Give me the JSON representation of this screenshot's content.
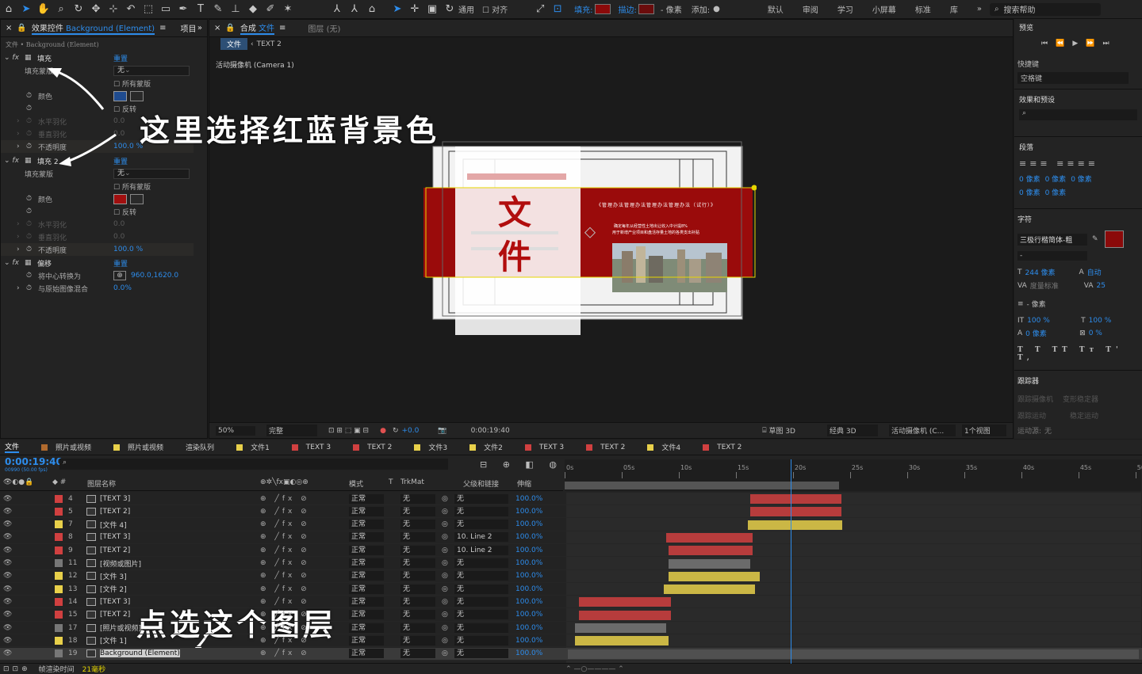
{
  "toolbar": {
    "snap_label": "通用",
    "align_label": "对齐",
    "fill_label": "填充:",
    "stroke_label": "描边:",
    "stroke_px": "- 像素",
    "add_label": "添加:",
    "workspaces": [
      "默认",
      "审阅",
      "学习",
      "小屏幕",
      "标准",
      "库"
    ],
    "search_help": "搜索帮助"
  },
  "effects_panel": {
    "tab": "效果控件",
    "layer_name": "Background (Element)",
    "tab2": "项目",
    "breadcrumb": "文件 • Background (Element)",
    "fill1": {
      "name": "填充",
      "reset": "重置",
      "mask_label": "填充蒙版",
      "mask_value": "无",
      "all_masks": "所有蒙版",
      "color_label": "颜色",
      "color": "#1f4b8e",
      "invert": "反转",
      "h_feather": "水平羽化",
      "h_feather_val": "0.0",
      "v_feather": "垂直羽化",
      "v_feather_val": "0.0",
      "opacity_label": "不透明度",
      "opacity": "100.0 %"
    },
    "fill2": {
      "name": "填充 2",
      "reset": "重置",
      "mask_label": "填充蒙版",
      "mask_value": "无",
      "all_masks": "所有蒙版",
      "color_label": "颜色",
      "color": "#a00f0f",
      "invert": "反转",
      "h_feather": "水平羽化",
      "h_feather_val": "0.0",
      "v_feather": "垂直羽化",
      "v_feather_val": "0.0",
      "opacity_label": "不透明度",
      "opacity": "100.0 %"
    },
    "offset": {
      "name": "偏移",
      "reset": "重置",
      "shift_label": "将中心转换为",
      "shift_val": "960.0,1620.0",
      "blend_label": "与原始图像混合",
      "blend_val": "0.0%"
    }
  },
  "comp_panel": {
    "tab_prefix": "合成",
    "tab_name": "文件",
    "layer_tab": "图层 (无)",
    "crumb1": "文件",
    "crumb2": "TEXT 2",
    "camera_label": "活动摄像机 (Camera 1)",
    "zoom": "50%",
    "quality": "完整",
    "exposure": "+0.0",
    "timecode": "0:00:19:40",
    "draft3d": "草图 3D",
    "renderer": "经典 3D",
    "camera_dd": "活动摄像机 (C...",
    "views": "1个视图"
  },
  "canvas": {
    "title_char1": "文",
    "title_char2": "件",
    "doc_title": "《管理办法管理办法管理办法管理办法（试行）》",
    "doc_line1": "确定每年从经营性土地出让收入中计提8%",
    "doc_line2": "用于新增产业项目和盘活存量土地的各类支出补贴"
  },
  "annotations": {
    "top": "这里选择红蓝背景色",
    "bottom": "点选这个图层"
  },
  "right_panel": {
    "preview": "预览",
    "shortcut": "快捷键",
    "shortcut_val": "空格键",
    "effects_presets": "效果和预设",
    "paragraph": "段落",
    "para_vals": [
      "0 像素",
      "0 像素",
      "0 像素",
      "0 像素",
      "0 像素"
    ],
    "character": "字符",
    "font": "三极行楷简体-粗",
    "font_style": "-",
    "font_size": "244 像素",
    "leading": "自动",
    "kerning": "度量标准",
    "tracking": "25",
    "stroke_w": "- 像素",
    "vscale": "100 %",
    "hscale": "100 %",
    "baseline": "0 像素",
    "tsume": "0 %",
    "text_color": "#8b0a0a",
    "tracker": "跟踪器",
    "track_camera": "跟踪摄像机",
    "warp_stab": "变形稳定器",
    "track_motion": "跟踪运动",
    "stabilize": "稳定运动",
    "motion_source": "运动源:",
    "motion_source_val": "无"
  },
  "timeline": {
    "tabs": [
      {
        "name": "文件",
        "color": "",
        "active": true
      },
      {
        "name": "照片或视频",
        "color": "#b06a2e"
      },
      {
        "name": "照片或视频",
        "color": "#e8d04a"
      },
      {
        "name": "渲染队列",
        "color": ""
      },
      {
        "name": "文件1",
        "color": "#e8d04a"
      },
      {
        "name": "TEXT 3",
        "color": "#d04040"
      },
      {
        "name": "TEXT 2",
        "color": "#d04040"
      },
      {
        "name": "文件3",
        "color": "#e8d04a"
      },
      {
        "name": "文件2",
        "color": "#e8d04a"
      },
      {
        "name": "TEXT 3",
        "color": "#d04040"
      },
      {
        "name": "TEXT 2",
        "color": "#d04040"
      },
      {
        "name": "文件4",
        "color": "#e8d04a"
      },
      {
        "name": "TEXT 2",
        "color": "#d04040"
      }
    ],
    "current_time": "0:00:19:40",
    "frame_info": "00990 (50.00 fps)",
    "col_name": "图层名称",
    "col_mode": "模式",
    "col_t": "T",
    "col_trkmat": "TrkMat",
    "col_parent": "父级和链接",
    "col_stretch": "伸缩",
    "ruler": [
      "0s",
      "05s",
      "10s",
      "15s",
      "20s",
      "25s",
      "30s",
      "35s",
      "40s",
      "45s",
      "50s"
    ],
    "playhead_sec": 19.8,
    "work_area_sec": [
      0,
      24
    ],
    "layers": [
      {
        "num": "4",
        "name": "[TEXT 3]",
        "color": "#d04040",
        "mode": "正常",
        "trk": "无",
        "parent": "无",
        "stretch": "100.0%",
        "start": 16,
        "end": 24
      },
      {
        "num": "5",
        "name": "[TEXT 2]",
        "color": "#d04040",
        "mode": "正常",
        "trk": "无",
        "parent": "无",
        "stretch": "100.0%",
        "start": 16,
        "end": 24
      },
      {
        "num": "7",
        "name": "[文件 4]",
        "color": "#e8d04a",
        "mode": "正常",
        "trk": "无",
        "parent": "无",
        "stretch": "100.0%",
        "start": 15.8,
        "end": 24
      },
      {
        "num": "8",
        "name": "[TEXT 3]",
        "color": "#d04040",
        "mode": "正常",
        "trk": "无",
        "parent": "10. Line 2",
        "stretch": "100.0%",
        "start": 8.6,
        "end": 16.2
      },
      {
        "num": "9",
        "name": "[TEXT 2]",
        "color": "#d04040",
        "mode": "正常",
        "trk": "无",
        "parent": "10. Line 2",
        "stretch": "100.0%",
        "start": 8.8,
        "end": 16.2
      },
      {
        "num": "11",
        "name": "[视频或图片]",
        "color": "#777777",
        "mode": "正常",
        "trk": "无",
        "parent": "无",
        "stretch": "100.0%",
        "start": 8.8,
        "end": 16
      },
      {
        "num": "12",
        "name": "[文件 3]",
        "color": "#e8d04a",
        "mode": "正常",
        "trk": "无",
        "parent": "无",
        "stretch": "100.0%",
        "start": 8.8,
        "end": 16.8
      },
      {
        "num": "13",
        "name": "[文件 2]",
        "color": "#e8d04a",
        "mode": "正常",
        "trk": "无",
        "parent": "无",
        "stretch": "100.0%",
        "start": 8.4,
        "end": 16.4
      },
      {
        "num": "14",
        "name": "[TEXT 3]",
        "color": "#d04040",
        "mode": "正常",
        "trk": "无",
        "parent": "无",
        "stretch": "100.0%",
        "start": 1,
        "end": 9
      },
      {
        "num": "15",
        "name": "[TEXT 2]",
        "color": "#d04040",
        "mode": "正常",
        "trk": "无",
        "parent": "无",
        "stretch": "100.0%",
        "start": 1,
        "end": 9
      },
      {
        "num": "17",
        "name": "[照片或视频]",
        "color": "#777777",
        "mode": "正常",
        "trk": "无",
        "parent": "无",
        "stretch": "100.0%",
        "start": 0.6,
        "end": 8.6
      },
      {
        "num": "18",
        "name": "[文件 1]",
        "color": "#e8d04a",
        "mode": "正常",
        "trk": "无",
        "parent": "无",
        "stretch": "100.0%",
        "start": 0.6,
        "end": 8.8
      },
      {
        "num": "19",
        "name": "Background (Element)",
        "color": "#777777",
        "mode": "正常",
        "trk": "无",
        "parent": "无",
        "stretch": "100.0%",
        "start": 0,
        "end": 50,
        "selected": true
      }
    ],
    "footer_label": "帧渲染时间",
    "footer_val": "21毫秒"
  }
}
